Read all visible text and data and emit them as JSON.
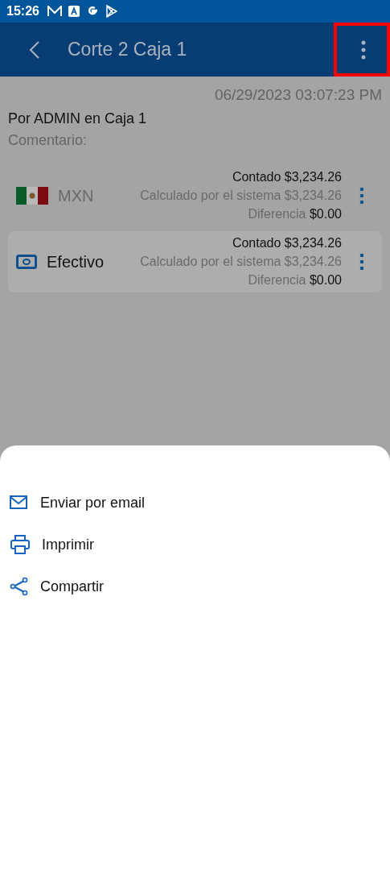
{
  "status_bar": {
    "time": "15:26"
  },
  "app_bar": {
    "title": "Corte 2 Caja 1"
  },
  "header": {
    "timestamp": "06/29/2023 03:07:23 PM",
    "author": "Por ADMIN en Caja 1",
    "comment_label": "Comentario:"
  },
  "rows": [
    {
      "kind": "flag",
      "label": "MXN",
      "highlighted": false,
      "counted_label": "Contado",
      "counted": "$3,234.26",
      "calculated_label": "Calculado por el sistema",
      "calculated": "$3,234.26",
      "difference_label": "Diferencia",
      "difference": "$0.00"
    },
    {
      "kind": "cash",
      "label": "Efectivo",
      "highlighted": true,
      "counted_label": "Contado",
      "counted": "$3,234.26",
      "calculated_label": "Calculado por el sistema",
      "calculated": "$3,234.26",
      "difference_label": "Diferencia",
      "difference": "$0.00"
    }
  ],
  "sheet": {
    "items": [
      {
        "kind": "email",
        "label": "Enviar por email"
      },
      {
        "kind": "print",
        "label": "Imprimir"
      },
      {
        "kind": "share",
        "label": "Compartir"
      }
    ]
  }
}
